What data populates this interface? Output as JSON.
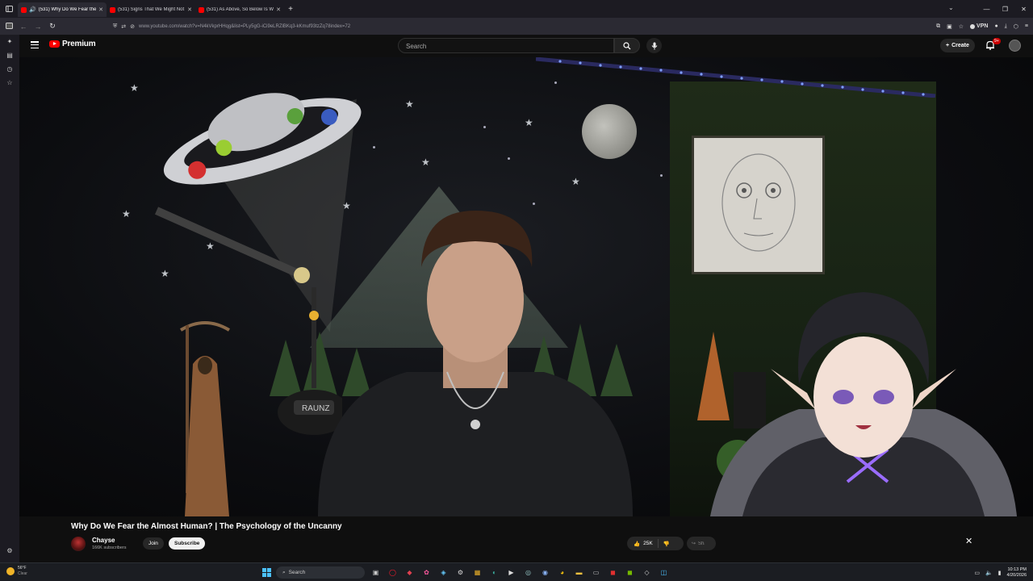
{
  "browser": {
    "tabs": [
      {
        "label": "(531) Why Do We Fear the",
        "active": true,
        "playing": true
      },
      {
        "label": "(531) Signs That We Might Not",
        "active": false,
        "playing": false
      },
      {
        "label": "(531) As Above, So Below Is Wr",
        "active": false,
        "playing": false
      }
    ],
    "new_tab_symbol": "+",
    "url": "www.youtube.com/watch?v=N4kVkprHHqg&list=PLy5gG-iCi9eLRZlBKq3-kKmuf93tzZq78index=72",
    "vpn_label": "VPN"
  },
  "youtube": {
    "logo_text": "Premium",
    "search_placeholder": "Search",
    "create_label": "Create",
    "notification_count": "9+"
  },
  "video": {
    "title": "Why Do We Fear the Almost Human? | The Psychology of the Uncanny",
    "channel_name": "Chayse",
    "subscribers": "166K subscribers",
    "join_label": "Join",
    "subscribe_label": "Subscribe",
    "likes": "25K",
    "share_label": "Share"
  },
  "taskbar": {
    "weather_temp": "56°F",
    "weather_cond": "Clear",
    "search_label": "Search",
    "time": "10:13 PM",
    "date": "4/20/2026"
  },
  "colors": {
    "youtube_red": "#ff0000",
    "accent_blue": "#4cc2ff",
    "background": "#0f0f0f"
  },
  "icons": [
    "sidebar-icon",
    "speaker-icon",
    "close-icon",
    "back-icon",
    "forward-icon",
    "reload-icon",
    "shield-icon",
    "lock-icon",
    "bookmark-icon",
    "menu-icon",
    "search-icon",
    "mic-icon",
    "bell-icon",
    "like-icon",
    "dislike-icon",
    "share-icon",
    "windows-icon"
  ]
}
